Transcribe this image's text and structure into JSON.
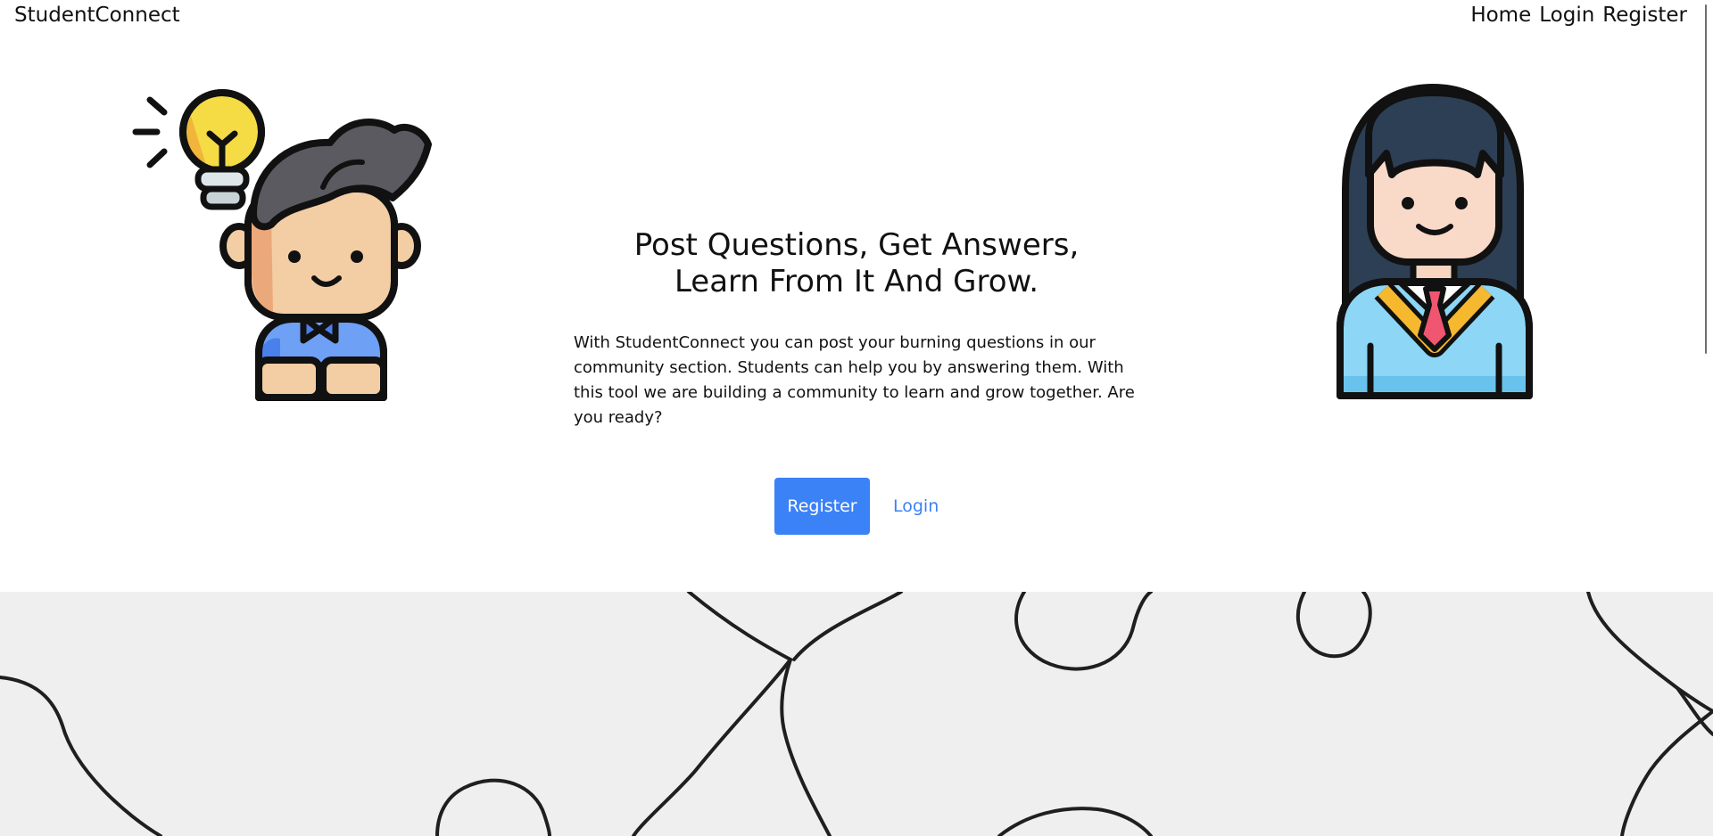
{
  "nav": {
    "brand": "StudentConnect",
    "links": [
      {
        "label": "Home"
      },
      {
        "label": "Login"
      },
      {
        "label": "Register"
      }
    ]
  },
  "hero": {
    "title_line1": "Post Questions, Get Answers,",
    "title_line2": "Learn From It And Grow.",
    "description": "With StudentConnect you can post your burning questions in our community section. Students can help you by answering them. With this tool we are building a community to learn and grow together. Are you ready?",
    "register_button": "Register",
    "login_link": "Login"
  },
  "illustrations": {
    "left": "student-with-lightbulb-icon",
    "right": "graduate-student-icon"
  },
  "background": "puzzle-pieces-image",
  "colors": {
    "accent": "#3b82f6",
    "text": "#111111",
    "background": "#ffffff"
  }
}
